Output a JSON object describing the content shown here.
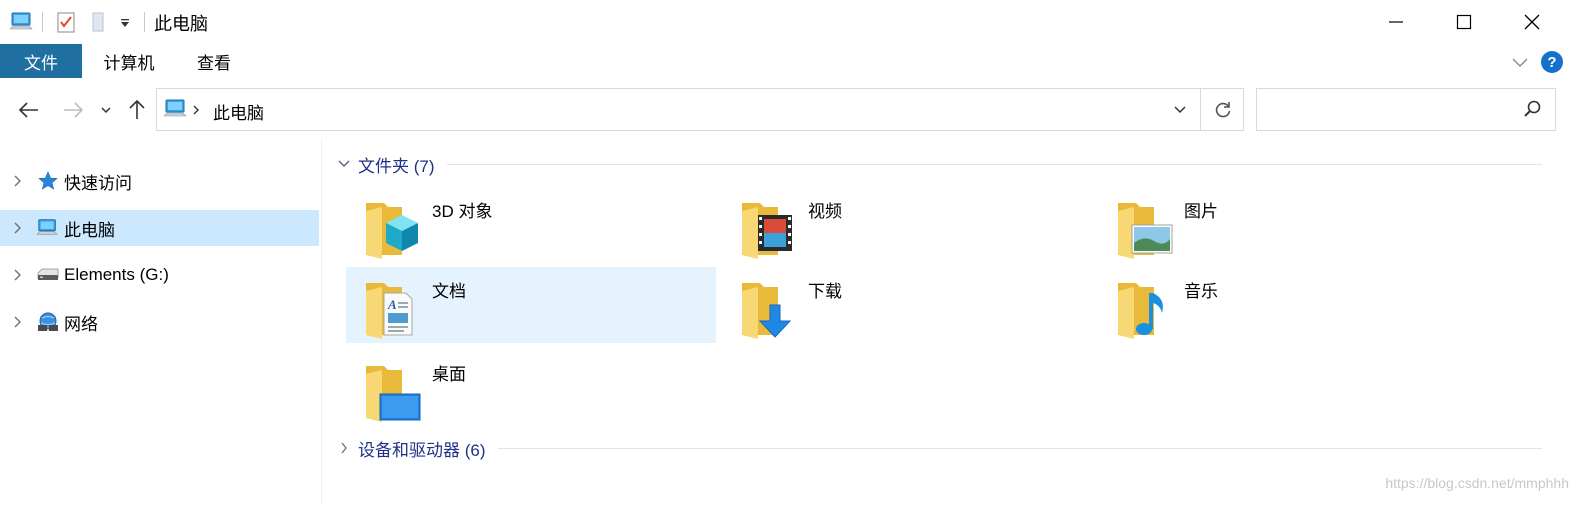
{
  "window": {
    "title": "此电脑",
    "controls": {
      "minimize_icon": "minimize-icon",
      "maximize_icon": "maximize-icon",
      "close_icon": "close-icon"
    }
  },
  "quick_access_toolbar": {
    "icons": [
      "computer-icon",
      "properties-icon",
      "new-folder-icon",
      "customize-dropdown-icon"
    ]
  },
  "ribbon": {
    "tabs": [
      {
        "label": "文件",
        "active": true
      },
      {
        "label": "计算机",
        "active": false
      },
      {
        "label": "查看",
        "active": false
      }
    ],
    "expand_icon": "chevron-down-icon",
    "help_icon": "help-icon"
  },
  "navigation": {
    "back_icon": "back-arrow-icon",
    "forward_icon": "forward-arrow-icon",
    "recent_icon": "chevron-down-icon",
    "up_icon": "up-arrow-icon"
  },
  "address_bar": {
    "location": "此电脑",
    "location_icon": "computer-icon",
    "dropdown_icon": "chevron-down-icon",
    "refresh_icon": "refresh-icon"
  },
  "search": {
    "placeholder": "",
    "value": "",
    "icon": "search-icon"
  },
  "sidebar": {
    "items": [
      {
        "label": "快速访问",
        "icon": "star-pin-icon",
        "selected": false
      },
      {
        "label": "此电脑",
        "icon": "computer-icon",
        "selected": true
      },
      {
        "label": "Elements (G:)",
        "icon": "drive-icon",
        "selected": false
      },
      {
        "label": "网络",
        "icon": "network-icon",
        "selected": false
      }
    ]
  },
  "main": {
    "groups": [
      {
        "title": "文件夹 (7)",
        "expanded": true,
        "items": [
          {
            "label": "3D 对象",
            "icon": "3d-objects-folder-icon"
          },
          {
            "label": "视频",
            "icon": "videos-folder-icon"
          },
          {
            "label": "图片",
            "icon": "pictures-folder-icon"
          },
          {
            "label": "文档",
            "icon": "documents-folder-icon",
            "hover": true
          },
          {
            "label": "下载",
            "icon": "downloads-folder-icon"
          },
          {
            "label": "音乐",
            "icon": "music-folder-icon"
          },
          {
            "label": "桌面",
            "icon": "desktop-folder-icon"
          }
        ]
      },
      {
        "title": "设备和驱动器 (6)",
        "expanded": false,
        "items": []
      }
    ]
  },
  "watermark": "https://blog.csdn.net/mmphhh",
  "colors": {
    "accent": "#1f6fa1",
    "selection": "#cce8ff",
    "hover": "#e5f3ff",
    "group_title": "#1e3287",
    "folder_yellow": "#f6c94c"
  }
}
